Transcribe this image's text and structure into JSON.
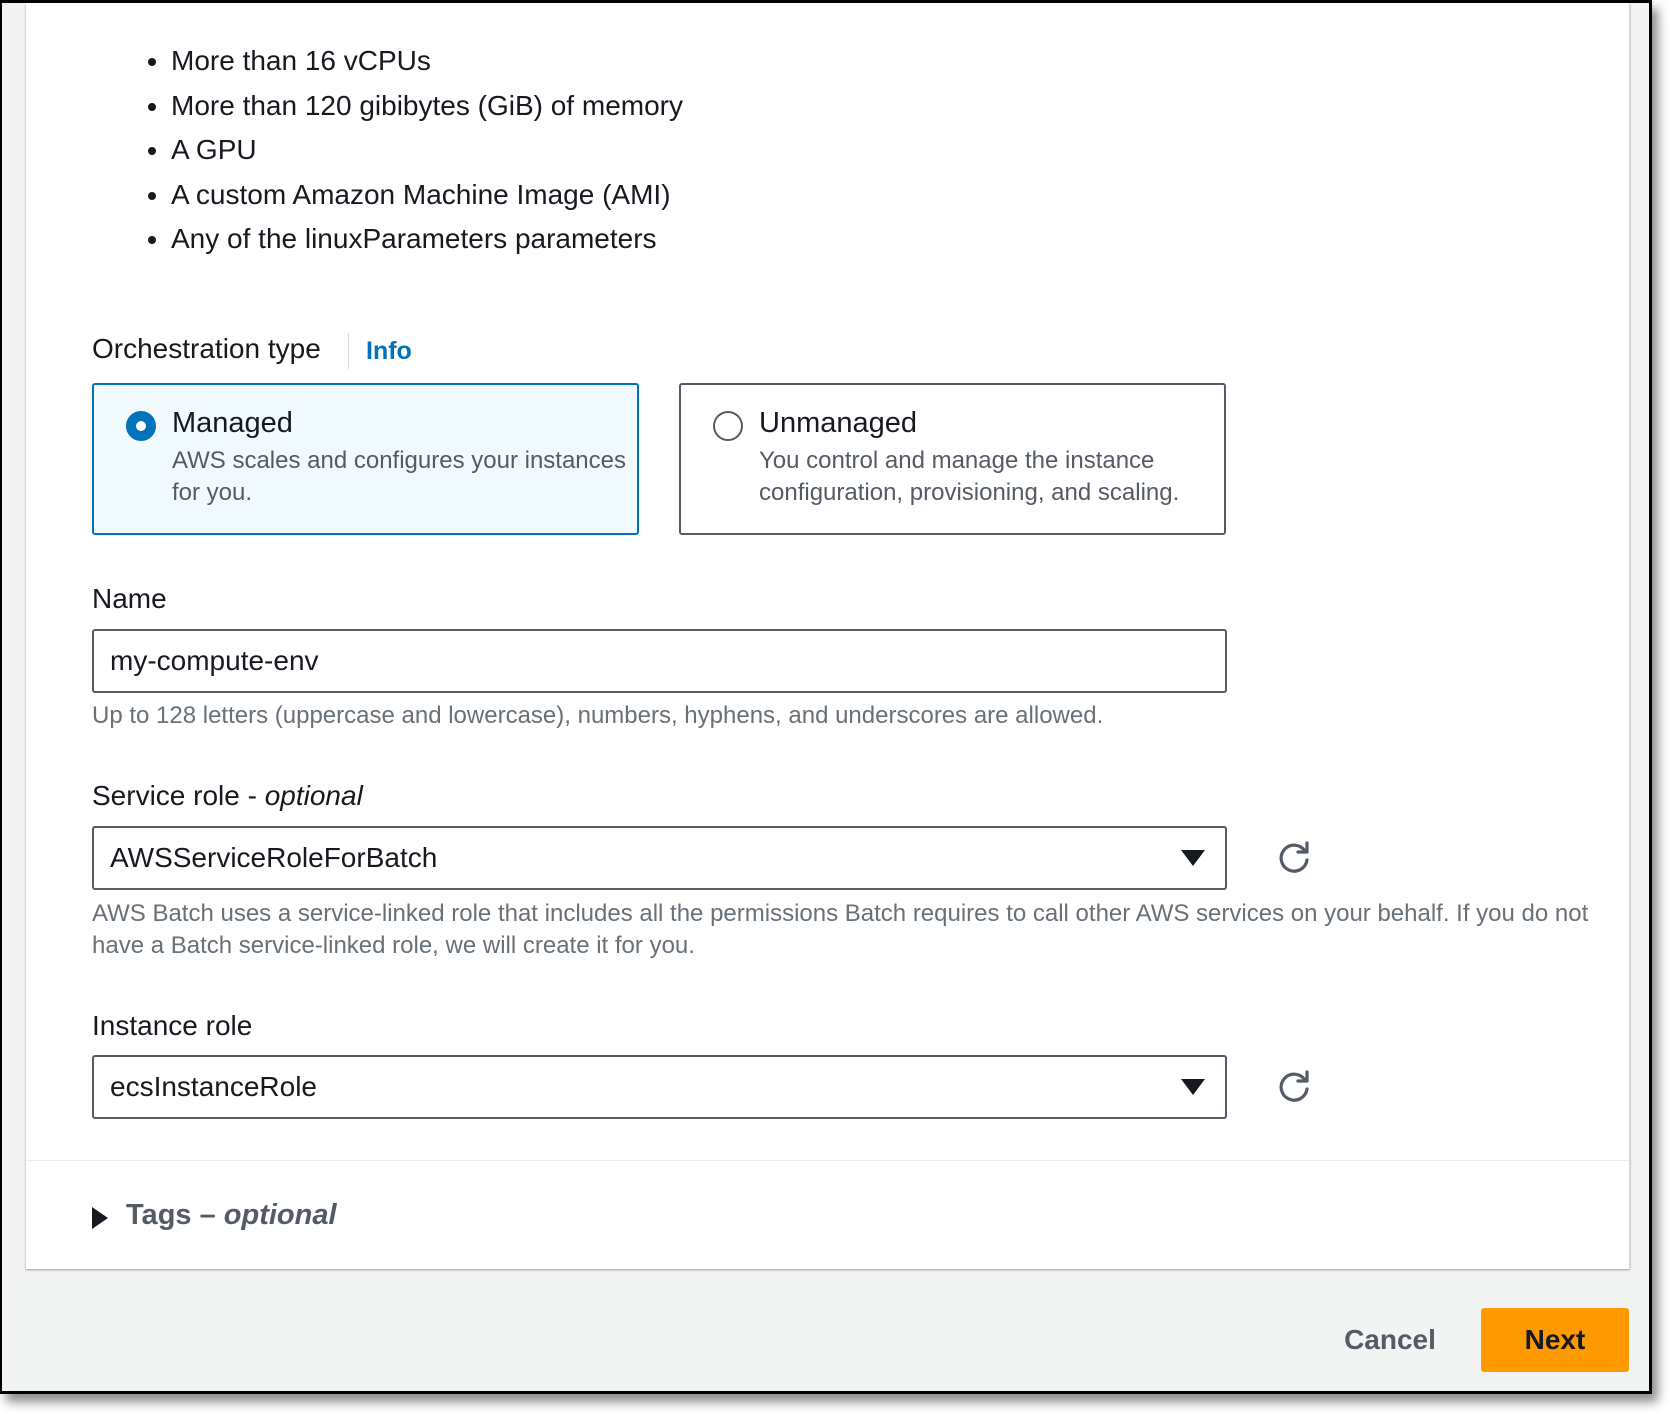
{
  "requirements": {
    "items": [
      "More than 16 vCPUs",
      "More than 120 gibibytes (GiB) of memory",
      "A GPU",
      "A custom Amazon Machine Image (AMI)",
      "Any of the linuxParameters parameters"
    ]
  },
  "orchestration": {
    "label": "Orchestration type",
    "info_link": "Info",
    "selected": "managed",
    "options": [
      {
        "title": "Managed",
        "description": "AWS scales and configures your instances for you."
      },
      {
        "title": "Unmanaged",
        "description": "You control and manage the instance configuration, provisioning, and scaling."
      }
    ]
  },
  "name": {
    "label": "Name",
    "value": "my-compute-env",
    "hint": "Up to 128 letters (uppercase and lowercase), numbers, hyphens, and underscores are allowed."
  },
  "service_role": {
    "label": "Service role - ",
    "label_optional": "optional",
    "value": "AWSServiceRoleForBatch",
    "hint": "AWS Batch uses a service-linked role that includes all the permissions Batch requires to call other AWS services on your behalf. If you do not have a Batch service-linked role, we will create it for you."
  },
  "instance_role": {
    "label": "Instance role",
    "value": "ecsInstanceRole"
  },
  "tags": {
    "label": "Tags – ",
    "label_optional": "optional"
  },
  "footer": {
    "cancel_label": "Cancel",
    "next_label": "Next"
  },
  "icons": {
    "refresh": "refresh-icon",
    "dropdown": "caret-down-icon",
    "expand": "caret-right-icon"
  },
  "colors": {
    "primary_button": "#ff9900",
    "link": "#0073bb",
    "selected_tile_border": "#0073bb",
    "selected_tile_bg": "#f1faff",
    "hint_text": "#687078"
  }
}
